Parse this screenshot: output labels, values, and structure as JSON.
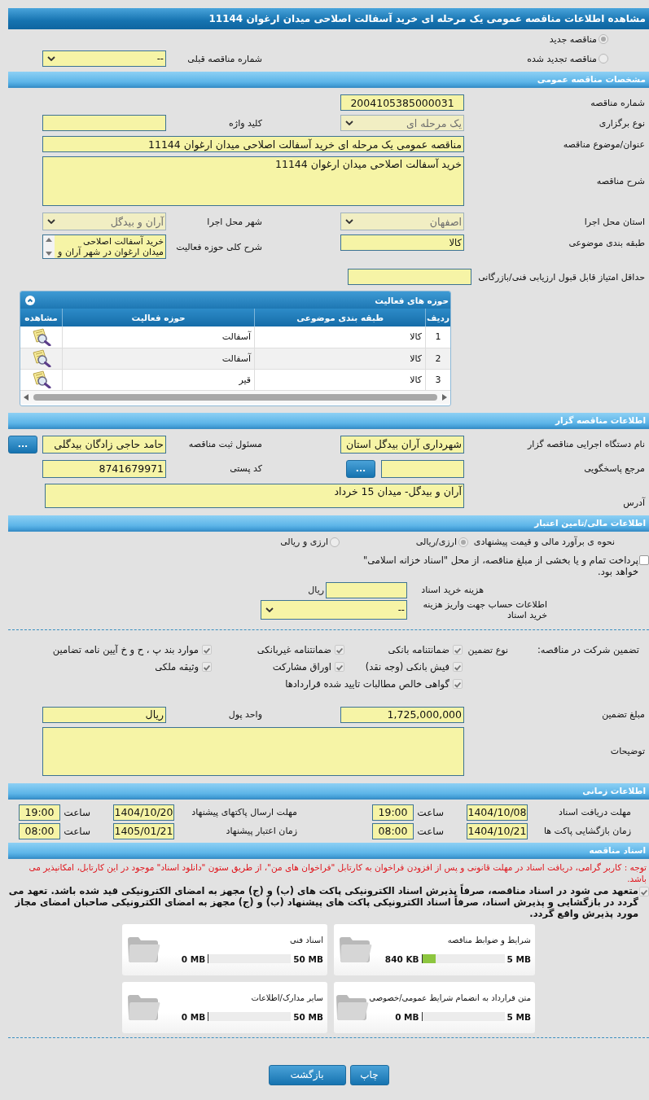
{
  "header": {
    "title": "مشاهده اطلاعات مناقصه عمومی یک مرحله ای خرید آسفالت اصلاحی میدان ارغوان 11144"
  },
  "tender_type": {
    "options": [
      {
        "label": "مناقصه جدید",
        "selected": true
      },
      {
        "label": "مناقصه تجدید شده",
        "selected": false
      }
    ],
    "previous_number": {
      "label": "شماره مناقصه قبلی",
      "value": "--",
      "disabled": false
    }
  },
  "general": {
    "title": "مشخصات مناقصه عمومی",
    "number": {
      "label": "شماره مناقصه",
      "value": "2004105385000031"
    },
    "holding_type": {
      "label": "نوع برگزاری",
      "value": "یک مرحله ای",
      "disabled": true
    },
    "keyword": {
      "label": "کلید واژه"
    },
    "subject": {
      "label": "عنوان/موضوع مناقصه",
      "value": "مناقصه عمومی یک مرحله ای خرید آسفالت اصلاحی میدان ارغوان 11144"
    },
    "description": {
      "label": "شرح مناقصه",
      "value": "خرید آسفالت اصلاحی میدان ارغوان 11144"
    },
    "province": {
      "label": "استان محل اجرا",
      "value": "اصفهان",
      "disabled": true
    },
    "city": {
      "label": "شهر محل اجرا",
      "value": "آران و بیدگل",
      "disabled": true
    },
    "category": {
      "label": "طبقه بندی موضوعی",
      "value": "کالا"
    },
    "scope_description": {
      "label": "شرح کلی حوزه فعالیت",
      "lines": [
        "خرید آسفالت اصلاحی",
        "میدان ارغوان در شهر آران و"
      ]
    },
    "min_score": {
      "label": "حداقل امتیاز قابل قبول ارزیابی فنی/بازرگانی"
    }
  },
  "activities": {
    "title": "حوزه های فعالیت",
    "columns": [
      "ردیف",
      "طبقه بندی موضوعی",
      "حوزه فعالیت",
      "مشاهده"
    ],
    "rows": [
      {
        "index": "1",
        "category": "کالا",
        "field": "آسفالت"
      },
      {
        "index": "2",
        "category": "کالا",
        "field": "آسفالت"
      },
      {
        "index": "3",
        "category": "کالا",
        "field": "قیر"
      }
    ]
  },
  "organizer": {
    "title": "اطلاعات مناقصه گزار",
    "agency": {
      "label": "نام دستگاه اجرایی مناقصه گزار",
      "value": "شهرداری آران بیدگل استان"
    },
    "registrar": {
      "label": "مسئول ثبت مناقصه",
      "value": "حامد حاجی زادگان بیدگلی",
      "button": "..."
    },
    "reference": {
      "label": "مرجع پاسخگویی",
      "button": "..."
    },
    "postal_code": {
      "label": "کد پستی",
      "value": "8741679971"
    },
    "address": {
      "label": "آدرس",
      "value": "آران و بیدگل- میدان 15 خرداد"
    }
  },
  "finance": {
    "title": "اطلاعات مالی/تامین اعتبار",
    "estimate": {
      "label": "نحوه ی برآورد مالی و قیمت پیشنهادی",
      "options": [
        {
          "label": "ارزی/ریالی",
          "selected": true
        },
        {
          "label": "ارزی و ریالی",
          "selected": false
        }
      ]
    },
    "treasury": {
      "label": "پرداخت تمام و یا بخشی از مبلغ مناقصه، از محل \"اسناد خزانه اسلامی\" خواهد بود.",
      "checked": false
    },
    "doc_fee": {
      "label": "هزینه خرید اسناد",
      "unit": "ریال"
    },
    "account": {
      "label": "اطلاعات حساب جهت واریز هزینه خرید اسناد",
      "value": "--",
      "disabled": false
    }
  },
  "guarantee": {
    "label": "تضمین شرکت در مناقصه:",
    "type_label": "نوع تضمین",
    "types": [
      {
        "label": "ضمانتنامه بانکی",
        "checked": true
      },
      {
        "label": "ضمانتنامه غیربانکی",
        "checked": true
      },
      {
        "label": "موارد بند پ ، ح و خ آیین نامه تضامین",
        "checked": true
      },
      {
        "label": "فیش بانکی (وجه نقد)",
        "checked": true
      },
      {
        "label": "اوراق مشارکت",
        "checked": true
      },
      {
        "label": "وثیقه ملکی",
        "checked": true
      },
      {
        "label": "گواهی خالص مطالبات تایید شده قراردادها",
        "checked": true
      }
    ],
    "amount": {
      "label": "مبلغ تضمین",
      "value": "1,725,000,000"
    },
    "currency": {
      "label": "واحد پول",
      "value": "ریال"
    },
    "notes": {
      "label": "توضیحات"
    }
  },
  "timing": {
    "title": "اطلاعات زمانی",
    "rows": [
      {
        "label": "مهلت دریافت اسناد",
        "date": "1404/10/08",
        "time_label": "ساعت",
        "time": "19:00"
      },
      {
        "label": "مهلت ارسال پاکتهای پیشنهاد",
        "date": "1404/10/20",
        "time_label": "ساعت",
        "time": "19:00"
      },
      {
        "label": "زمان بازگشایی پاکت ها",
        "date": "1404/10/21",
        "time_label": "ساعت",
        "time": "08:00"
      },
      {
        "label": "زمان اعتبار پیشنهاد",
        "date": "1405/01/21",
        "time_label": "ساعت",
        "time": "08:00"
      }
    ]
  },
  "documents": {
    "title": "اسناد مناقصه",
    "notice": "توجه : کاربر گرامی، دریافت اسناد در مهلت قانونی و پس از افزودن فراخوان به کارتابل \"فراخوان های من\"، از طریق ستون \"دانلود اسناد\" موجود در این کارتابل، امکانپذیر می باشد.",
    "commitment": {
      "text": "متعهد می شود در اسناد مناقصه، صرفاً پذیرش اسناد الکترونیکی پاکت های (ب) و (ج) مجهز به امضای الکترونیکی قید شده باشد. تعهد می گردد در بازگشایی و پذیرش اسناد، صرفاً اسناد الکترونیکی پاکت های پیشنهاد (ب) و (ج) مجهز به امضای الکترونیکی صاحبان امضای مجاز مورد پذیرش واقع گردد.",
      "checked": true
    },
    "files": [
      {
        "name": "شرایط و ضوابط مناقصه",
        "limit": "5 MB",
        "used": "840 KB",
        "level": 0.17
      },
      {
        "name": "اسناد فنی",
        "limit": "50 MB",
        "used": "0 MB",
        "level": 0
      },
      {
        "name": "متن قرارداد به انضمام شرایط عمومی/خصوصی",
        "limit": "5 MB",
        "used": "0 MB",
        "level": 0
      },
      {
        "name": "سایر مدارک/اطلاعات",
        "limit": "50 MB",
        "used": "0 MB",
        "level": 0
      }
    ]
  },
  "buttons": [
    {
      "label": "چاپ"
    },
    {
      "label": "بازگشت"
    }
  ]
}
